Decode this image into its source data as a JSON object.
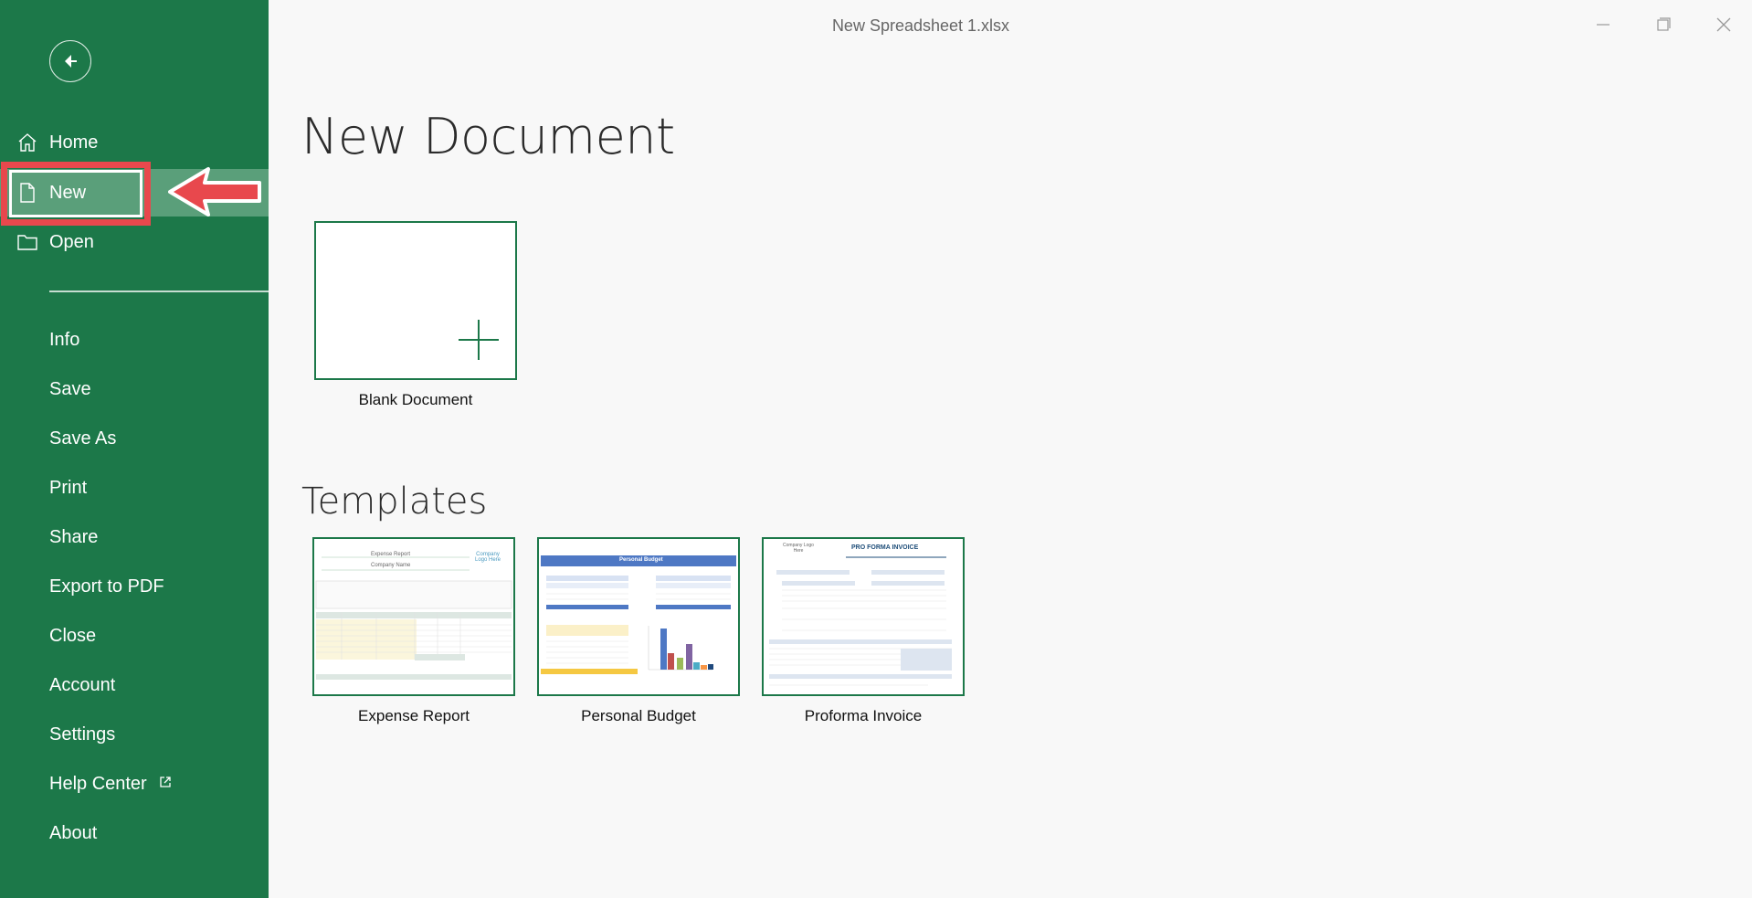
{
  "window": {
    "title": "New Spreadsheet 1.xlsx"
  },
  "sidebar": {
    "primary": [
      {
        "label": "Home",
        "icon": "home-icon"
      },
      {
        "label": "New",
        "icon": "new-file-icon"
      },
      {
        "label": "Open",
        "icon": "folder-icon"
      }
    ],
    "menu": [
      "Info",
      "Save",
      "Save As",
      "Print",
      "Share",
      "Export to PDF",
      "Close",
      "Account",
      "Settings",
      "Help Center",
      "About"
    ],
    "selected": "New"
  },
  "main": {
    "heading": "New Document",
    "blank": {
      "label": "Blank Document"
    },
    "templates_heading": "Templates",
    "templates": [
      {
        "label": "Expense Report",
        "preview": {
          "title": "Expense Report",
          "subtitle": "Company Name",
          "logo": "Company Logo Here"
        }
      },
      {
        "label": "Personal Budget",
        "preview": {
          "title": "Personal Budget"
        }
      },
      {
        "label": "Proforma Invoice",
        "preview": {
          "title": "PRO FORMA INVOICE",
          "logo": "Company Logo Here"
        }
      }
    ]
  },
  "colors": {
    "sidebar": "#1c7849",
    "selected_item": "#5a9f7a",
    "highlight": "#e8484d",
    "background": "#f8f8f8"
  }
}
